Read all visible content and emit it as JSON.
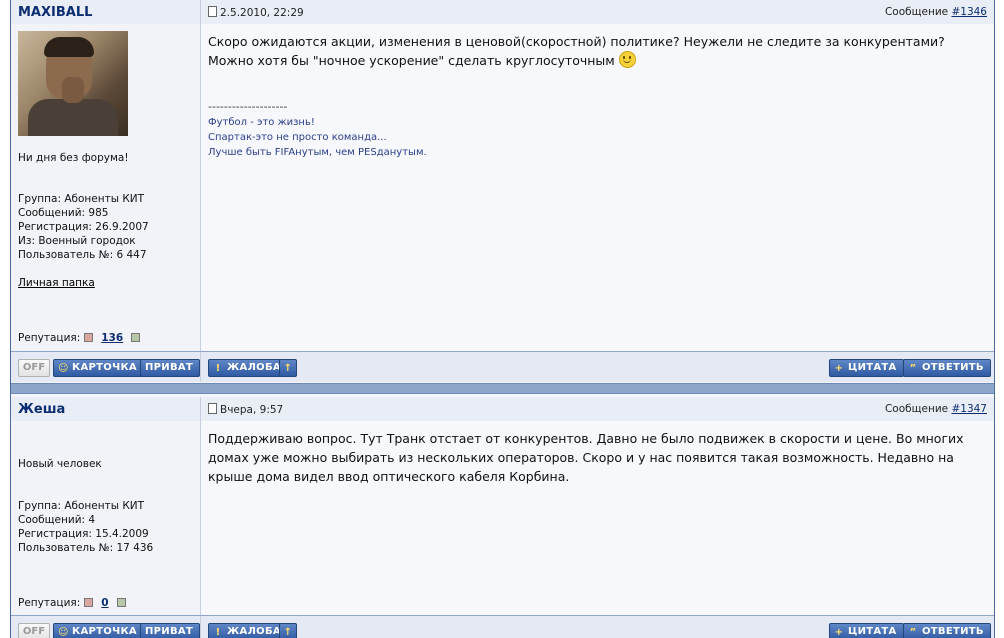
{
  "posts": [
    {
      "author": "MAXIBALL",
      "date": "2.5.2010, 22:29",
      "message_label": "Сообщение",
      "message_no": "#1346",
      "status": "Ни дня без форума!",
      "group": "Группа: Абоненты КИТ",
      "messages": "Сообщений: 985",
      "registered": "Регистрация: 26.9.2007",
      "from": "Из: Военный городок",
      "user_no": "Пользователь №: 6 447",
      "folder_link": "Личная папка",
      "reputation_label": "Репутация:",
      "reputation": "136",
      "text": "Скоро ожидаются акции, изменения в ценовой(скоростной) политике? Неужели не следите за конкурентами? Можно хотя бы \"ночное ускорение\" сделать круглосуточным",
      "signature_separator": "--------------------",
      "signature": [
        "Футбол - это жизнь!",
        "Спартак-это не просто команда...",
        "Лучше быть FIFAнутым, чем PESданутым."
      ]
    },
    {
      "author": "Жеша",
      "date": "Вчера, 9:57",
      "message_label": "Сообщение",
      "message_no": "#1347",
      "status": "Новый человек",
      "group": "Группа: Абоненты КИТ",
      "messages": "Сообщений: 4",
      "registered": "Регистрация: 15.4.2009",
      "user_no": "Пользователь №: 17 436",
      "reputation_label": "Репутация:",
      "reputation": "0",
      "text": "Поддерживаю вопрос. Тут Транк отстает от конкурентов. Давно не было подвижек в скорости и цене. Во многих домах уже можно выбирать из нескольких операторов. Скоро и у нас появится такая возможность. Недавно на крыше дома видел ввод оптического кабеля Корбина."
    }
  ],
  "buttons": {
    "off": "OFF",
    "card": "КАРТОЧКА",
    "private": "ПРИВАТ",
    "report": "ЖАЛОБА",
    "quote": "ЦИТАТА",
    "reply": "ОТВЕТИТЬ"
  },
  "icons": [
    "document-icon",
    "user-icon",
    "warning-icon",
    "up-arrow-icon",
    "plus-icon",
    "quote-icon",
    "smiley-icon",
    "minus-icon",
    "plus-square-icon"
  ],
  "colors": {
    "author": "#0b2e72",
    "button": "#2f5aa3",
    "divider": "#8da5c9",
    "signature": "#2a3e8a"
  }
}
